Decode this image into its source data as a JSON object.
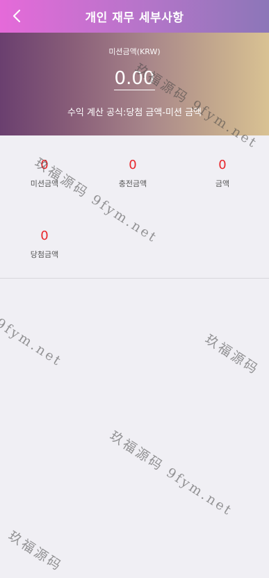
{
  "header": {
    "title": "개인 재무 세부사항",
    "back_icon": "chevron-left-icon"
  },
  "summary": {
    "label": "미션금액(KRW)",
    "value": "0.00",
    "formula": "수익 계산 공식:당첨 금액-미션 금액"
  },
  "stats": [
    {
      "value": "0",
      "label": "미션금액"
    },
    {
      "value": "0",
      "label": "충전금액"
    },
    {
      "value": "0",
      "label": "금액"
    },
    {
      "value": "0",
      "label": "당첨금액"
    }
  ],
  "watermark": {
    "text": "玖福源码 9fym.net",
    "text_tail": "9fym.net",
    "text_head": "玖福源码",
    "text_head_partial": "玖福源码"
  },
  "colors": {
    "header_gradient": [
      "#e56ad9",
      "#8c76b8"
    ],
    "banner_gradient": [
      "#6a3f6f",
      "#d9c293"
    ],
    "stat_value": "#e8262b",
    "background": "#f0eff4"
  }
}
